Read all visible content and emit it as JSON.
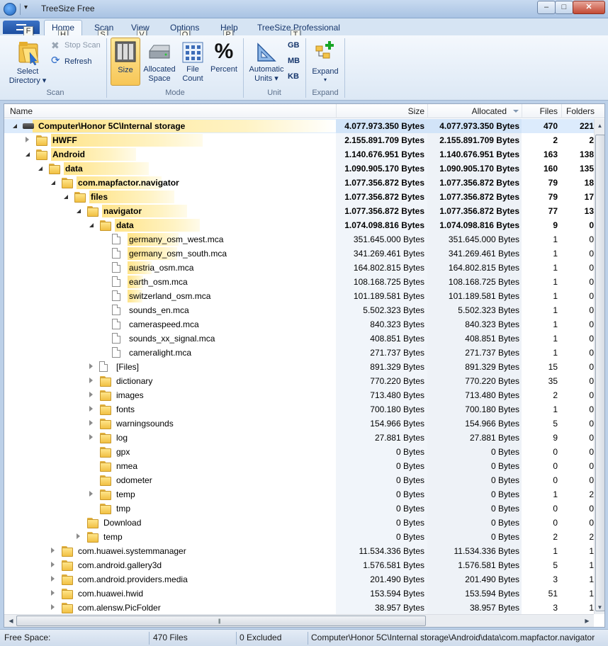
{
  "window": {
    "title": "TreeSize Free"
  },
  "tabs": [
    {
      "label": "Home",
      "keytip": "H"
    },
    {
      "label": "Scan",
      "keytip": "S"
    },
    {
      "label": "View",
      "keytip": "V"
    },
    {
      "label": "Options",
      "keytip": "O"
    },
    {
      "label": "Help",
      "keytip": "P"
    },
    {
      "label": "TreeSize Professional",
      "keytip": "T"
    }
  ],
  "file_tab_keytip": "F",
  "ribbon": {
    "scan_group": {
      "label": "Scan",
      "select_directory_line1": "Select",
      "select_directory_line2": "Directory",
      "stop_scan": "Stop Scan",
      "refresh": "Refresh"
    },
    "mode_group": {
      "label": "Mode",
      "size": "Size",
      "allocated_line1": "Allocated",
      "allocated_line2": "Space",
      "file_count_line1": "File",
      "file_count_line2": "Count",
      "percent": "Percent",
      "percent_glyph": "%"
    },
    "unit_group": {
      "label": "Unit",
      "automatic_line1": "Automatic",
      "automatic_line2": "Units",
      "gb": "GB",
      "mb": "MB",
      "kb": "KB"
    },
    "expand_group": {
      "label": "Expand",
      "expand": "Expand"
    }
  },
  "columns": {
    "name": "Name",
    "size": "Size",
    "allocated": "Allocated",
    "files": "Files",
    "folders": "Folders"
  },
  "rows": [
    {
      "name": "Computer\\Honor 5C\\Internal storage",
      "size": "4.077.973.350 Bytes",
      "allocated": "4.077.973.350 Bytes",
      "files": "470",
      "folders": "221",
      "bold": true,
      "selected": true,
      "icon": "drive-icon",
      "level": 0,
      "expander": "expanded",
      "bar": 1.0
    },
    {
      "name": "HWFF",
      "size": "2.155.891.709 Bytes",
      "allocated": "2.155.891.709 Bytes",
      "files": "2",
      "folders": "2",
      "bold": true,
      "icon": "folder-icon",
      "level": 1,
      "expander": "collapsed",
      "bar": 0.529
    },
    {
      "name": "Android",
      "size": "1.140.676.951 Bytes",
      "allocated": "1.140.676.951 Bytes",
      "files": "163",
      "folders": "138",
      "bold": true,
      "icon": "folder-icon",
      "level": 1,
      "expander": "expanded",
      "bar": 0.28
    },
    {
      "name": "data",
      "size": "1.090.905.170 Bytes",
      "allocated": "1.090.905.170 Bytes",
      "files": "160",
      "folders": "135",
      "bold": true,
      "icon": "folder-icon",
      "level": 2,
      "expander": "expanded",
      "bar": 0.956
    },
    {
      "name": "com.mapfactor.navigator",
      "size": "1.077.356.872 Bytes",
      "allocated": "1.077.356.872 Bytes",
      "files": "79",
      "folders": "18",
      "bold": true,
      "icon": "folder-icon",
      "level": 3,
      "expander": "expanded",
      "bar": 0.988
    },
    {
      "name": "files",
      "size": "1.077.356.872 Bytes",
      "allocated": "1.077.356.872 Bytes",
      "files": "79",
      "folders": "17",
      "bold": true,
      "icon": "folder-icon",
      "level": 4,
      "expander": "expanded",
      "bar": 1.0
    },
    {
      "name": "navigator",
      "size": "1.077.356.872 Bytes",
      "allocated": "1.077.356.872 Bytes",
      "files": "77",
      "folders": "13",
      "bold": true,
      "icon": "folder-icon",
      "level": 5,
      "expander": "expanded",
      "bar": 1.0
    },
    {
      "name": "data",
      "size": "1.074.098.816 Bytes",
      "allocated": "1.074.098.816 Bytes",
      "files": "9",
      "folders": "0",
      "bold": true,
      "icon": "folder-icon",
      "level": 6,
      "expander": "expanded",
      "bar": 0.997
    },
    {
      "name": "germany_osm_west.mca",
      "size": "351.645.000 Bytes",
      "allocated": "351.645.000 Bytes",
      "files": "1",
      "folders": "0",
      "icon": "file-icon",
      "level": 7,
      "expander": "none",
      "bar": 0.327
    },
    {
      "name": "germany_osm_south.mca",
      "size": "341.269.461 Bytes",
      "allocated": "341.269.461 Bytes",
      "files": "1",
      "folders": "0",
      "icon": "file-icon",
      "level": 7,
      "expander": "none",
      "bar": 0.318
    },
    {
      "name": "austria_osm.mca",
      "size": "164.802.815 Bytes",
      "allocated": "164.802.815 Bytes",
      "files": "1",
      "folders": "0",
      "icon": "file-icon",
      "level": 7,
      "expander": "none",
      "bar": 0.153
    },
    {
      "name": "earth_osm.mca",
      "size": "108.168.725 Bytes",
      "allocated": "108.168.725 Bytes",
      "files": "1",
      "folders": "0",
      "icon": "file-icon",
      "level": 7,
      "expander": "none",
      "bar": 0.1
    },
    {
      "name": "switzerland_osm.mca",
      "size": "101.189.581 Bytes",
      "allocated": "101.189.581 Bytes",
      "files": "1",
      "folders": "0",
      "icon": "file-icon",
      "level": 7,
      "expander": "none",
      "bar": 0.094
    },
    {
      "name": "sounds_en.mca",
      "size": "5.502.323 Bytes",
      "allocated": "5.502.323 Bytes",
      "files": "1",
      "folders": "0",
      "icon": "file-icon",
      "level": 7,
      "expander": "none",
      "bar": 0
    },
    {
      "name": "cameraspeed.mca",
      "size": "840.323 Bytes",
      "allocated": "840.323 Bytes",
      "files": "1",
      "folders": "0",
      "icon": "file-icon",
      "level": 7,
      "expander": "none",
      "bar": 0
    },
    {
      "name": "sounds_xx_signal.mca",
      "size": "408.851 Bytes",
      "allocated": "408.851 Bytes",
      "files": "1",
      "folders": "0",
      "icon": "file-icon",
      "level": 7,
      "expander": "none",
      "bar": 0
    },
    {
      "name": "cameralight.mca",
      "size": "271.737 Bytes",
      "allocated": "271.737 Bytes",
      "files": "1",
      "folders": "0",
      "icon": "file-icon",
      "level": 7,
      "expander": "none",
      "bar": 0
    },
    {
      "name": "[Files]",
      "size": "891.329 Bytes",
      "allocated": "891.329 Bytes",
      "files": "15",
      "folders": "0",
      "icon": "file-icon",
      "level": 6,
      "expander": "collapsed",
      "bar": 0
    },
    {
      "name": "dictionary",
      "size": "770.220 Bytes",
      "allocated": "770.220 Bytes",
      "files": "35",
      "folders": "0",
      "icon": "folder-icon",
      "level": 6,
      "expander": "collapsed",
      "bar": 0
    },
    {
      "name": "images",
      "size": "713.480 Bytes",
      "allocated": "713.480 Bytes",
      "files": "2",
      "folders": "0",
      "icon": "folder-icon",
      "level": 6,
      "expander": "collapsed",
      "bar": 0
    },
    {
      "name": "fonts",
      "size": "700.180 Bytes",
      "allocated": "700.180 Bytes",
      "files": "1",
      "folders": "0",
      "icon": "folder-icon",
      "level": 6,
      "expander": "collapsed",
      "bar": 0
    },
    {
      "name": "warningsounds",
      "size": "154.966 Bytes",
      "allocated": "154.966 Bytes",
      "files": "5",
      "folders": "0",
      "icon": "folder-icon",
      "level": 6,
      "expander": "collapsed",
      "bar": 0
    },
    {
      "name": "log",
      "size": "27.881 Bytes",
      "allocated": "27.881 Bytes",
      "files": "9",
      "folders": "0",
      "icon": "folder-icon",
      "level": 6,
      "expander": "collapsed",
      "bar": 0
    },
    {
      "name": "gpx",
      "size": "0 Bytes",
      "allocated": "0 Bytes",
      "files": "0",
      "folders": "0",
      "icon": "folder-icon",
      "level": 6,
      "expander": "none",
      "bar": 0
    },
    {
      "name": "nmea",
      "size": "0 Bytes",
      "allocated": "0 Bytes",
      "files": "0",
      "folders": "0",
      "icon": "folder-icon",
      "level": 6,
      "expander": "none",
      "bar": 0
    },
    {
      "name": "odometer",
      "size": "0 Bytes",
      "allocated": "0 Bytes",
      "files": "0",
      "folders": "0",
      "icon": "folder-icon",
      "level": 6,
      "expander": "none",
      "bar": 0
    },
    {
      "name": "temp",
      "size": "0 Bytes",
      "allocated": "0 Bytes",
      "files": "1",
      "folders": "2",
      "icon": "folder-icon",
      "level": 6,
      "expander": "collapsed",
      "bar": 0
    },
    {
      "name": "tmp",
      "size": "0 Bytes",
      "allocated": "0 Bytes",
      "files": "0",
      "folders": "0",
      "icon": "folder-icon",
      "level": 6,
      "expander": "none",
      "bar": 0
    },
    {
      "name": "Download",
      "size": "0 Bytes",
      "allocated": "0 Bytes",
      "files": "0",
      "folders": "0",
      "icon": "folder-icon",
      "level": 5,
      "expander": "none",
      "bar": 0
    },
    {
      "name": "temp",
      "size": "0 Bytes",
      "allocated": "0 Bytes",
      "files": "2",
      "folders": "2",
      "icon": "folder-icon",
      "level": 5,
      "expander": "collapsed",
      "bar": 0
    },
    {
      "name": "com.huawei.systemmanager",
      "size": "11.534.336 Bytes",
      "allocated": "11.534.336 Bytes",
      "files": "1",
      "folders": "1",
      "icon": "folder-icon",
      "level": 3,
      "expander": "collapsed",
      "bar": 0
    },
    {
      "name": "com.android.gallery3d",
      "size": "1.576.581 Bytes",
      "allocated": "1.576.581 Bytes",
      "files": "5",
      "folders": "1",
      "icon": "folder-icon",
      "level": 3,
      "expander": "collapsed",
      "bar": 0
    },
    {
      "name": "com.android.providers.media",
      "size": "201.490 Bytes",
      "allocated": "201.490 Bytes",
      "files": "3",
      "folders": "1",
      "icon": "folder-icon",
      "level": 3,
      "expander": "collapsed",
      "bar": 0
    },
    {
      "name": "com.huawei.hwid",
      "size": "153.594 Bytes",
      "allocated": "153.594 Bytes",
      "files": "51",
      "folders": "1",
      "icon": "folder-icon",
      "level": 3,
      "expander": "collapsed",
      "bar": 0
    },
    {
      "name": "com.alensw.PicFolder",
      "size": "38.957 Bytes",
      "allocated": "38.957 Bytes",
      "files": "3",
      "folders": "1",
      "icon": "folder-icon",
      "level": 3,
      "expander": "collapsed",
      "bar": 0
    }
  ],
  "status": {
    "free_space": "Free Space:",
    "files": "470  Files",
    "excluded": "0 Excluded",
    "path": "Computer\\Honor 5C\\Internal storage\\Android\\data\\com.mapfactor.navigator"
  },
  "colors": {
    "bar_yellow": "#ffe48a",
    "selection": "#dcebfc",
    "accent_blue": "#1d4fa0"
  }
}
